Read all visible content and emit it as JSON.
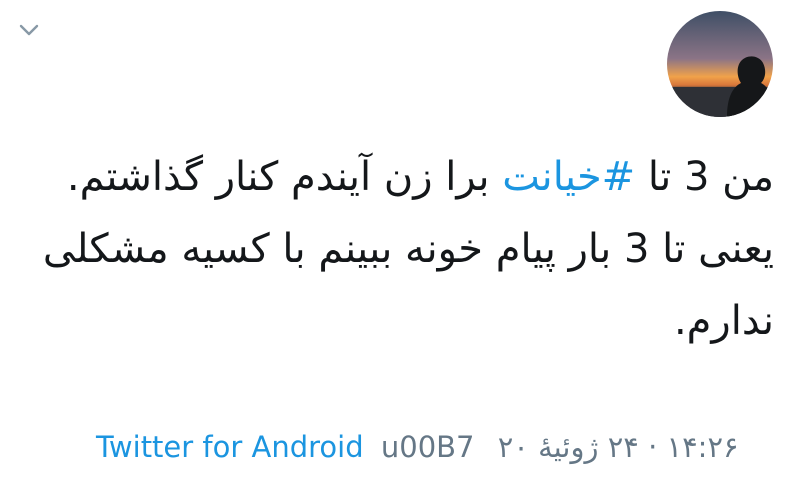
{
  "tweet": {
    "text_part1": "من 3 تا ",
    "hashtag": "#خیانت",
    "text_part2": " برا زن آیندم کنار گذاشتم.\nیعنی تا 3 بار پیام خونه ببینم با کسیه مشکلی ندارم.",
    "source": "Twitter for Android",
    "separator": "u00B7",
    "timestamp": "۱۴:۲۶ · ۲۴ ژوئیهٔ ۲۰"
  },
  "colors": {
    "link": "#1b95e0",
    "text": "#14171a",
    "meta": "#657786"
  },
  "icons": {
    "menu": "chevron-down-icon",
    "avatar": "avatar"
  }
}
